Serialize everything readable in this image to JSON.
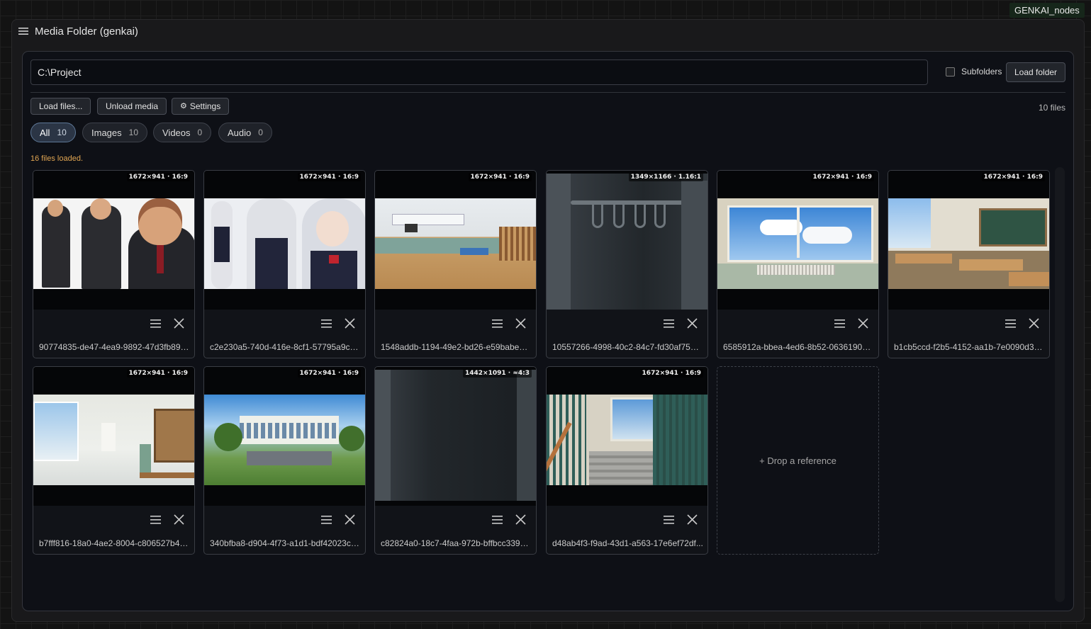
{
  "badge": "GENKAI_nodes",
  "node": {
    "title": "Media Folder (genkai)",
    "menu_icon": "hamburger-menu-icon"
  },
  "path_input": {
    "value": "C:\\Project"
  },
  "subfolders": {
    "label": "Subfolders",
    "checked": false
  },
  "buttons": {
    "load_folder": "Load folder",
    "load_files": "Load files...",
    "unload_media": "Unload media",
    "settings": "Settings"
  },
  "file_count": "10 files",
  "filters": [
    {
      "label": "All",
      "count": "10",
      "active": true
    },
    {
      "label": "Images",
      "count": "10",
      "active": false
    },
    {
      "label": "Videos",
      "count": "0",
      "active": false
    },
    {
      "label": "Audio",
      "count": "0",
      "active": false
    }
  ],
  "status": "16 files loaded.",
  "cards": [
    {
      "meta": "1672×941 · 16:9",
      "name": "90774835-de47-4ea9-9892-47d3fb89f3...",
      "scene": "character-sheet-man"
    },
    {
      "meta": "1672×941 · 16:9",
      "name": "c2e230a5-740d-416e-8cf1-57795a9cb1...",
      "scene": "character-sheet-elf-girl"
    },
    {
      "meta": "1672×941 · 16:9",
      "name": "1548addb-1194-49e2-bd26-e59babee1...",
      "scene": "gymnasium"
    },
    {
      "meta": "1349×1166 · 1.16:1",
      "name": "10557266-4998-40c2-84c7-fd30af75ee...",
      "scene": "locker-interior"
    },
    {
      "meta": "1672×941 · 16:9",
      "name": "6585912a-bbea-4ed6-8b52-063619033...",
      "scene": "window-sky"
    },
    {
      "meta": "1672×941 · 16:9",
      "name": "b1cb5ccd-f2b5-4152-aa1b-7e0090d38...",
      "scene": "classroom"
    },
    {
      "meta": "1672×941 · 16:9",
      "name": "b7fff816-18a0-4ae2-8004-c806527b49...",
      "scene": "school-hallway"
    },
    {
      "meta": "1672×941 · 16:9",
      "name": "340bfba8-d904-4f73-a1d1-bdf42023c5...",
      "scene": "school-exterior"
    },
    {
      "meta": "1442×1091 · ≈4:3",
      "name": "c82824a0-18c7-4faa-972b-bffbcc33969...",
      "scene": "dark-locker"
    },
    {
      "meta": "1672×941 · 16:9",
      "name": "d48ab4f3-f9ad-43d1-a563-17e6ef72df...",
      "scene": "stairwell"
    }
  ],
  "drop_zone": "+ Drop a reference",
  "colors": {
    "accent": "#5d7796",
    "status": "#e0a552",
    "panel": "#0e1016"
  }
}
